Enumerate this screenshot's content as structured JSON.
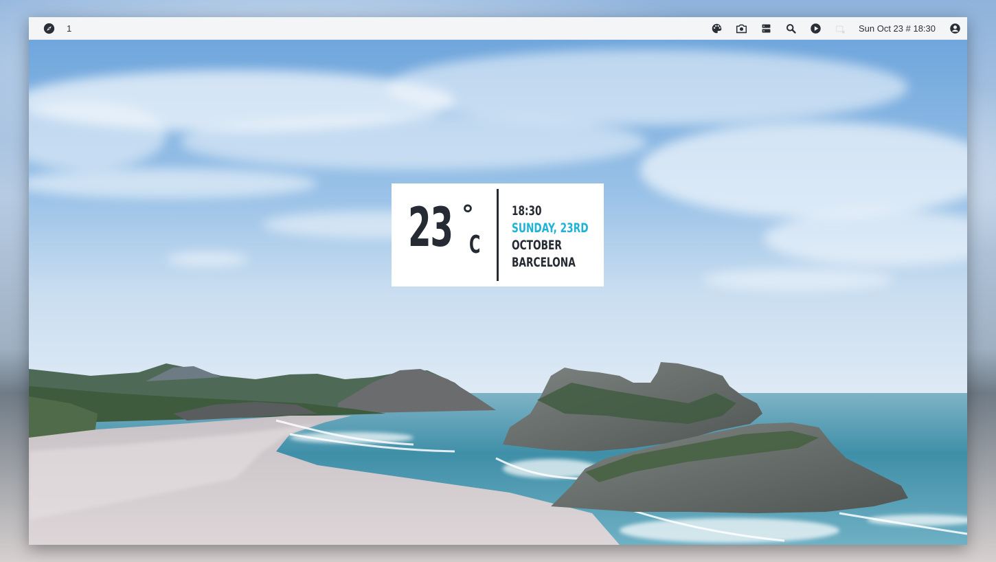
{
  "topbar": {
    "workspace_number": "1",
    "clock": "Sun Oct 23 # 18:30",
    "left_icons": [
      "compass-icon"
    ],
    "right_icons": [
      "palette-icon",
      "camera-icon",
      "server-icon",
      "search-icon",
      "play-icon",
      "battery-icon",
      "user-icon"
    ]
  },
  "widget": {
    "temperature": "23",
    "degree_symbol": "°",
    "unit": "C",
    "time": "18:30",
    "day": "SUNDAY, 23RD",
    "month": "OCTOBER",
    "city": "BARCELONA",
    "accent_color": "#1fb3d6",
    "text_color": "#252a33"
  },
  "colors": {
    "bar_background": "#f4f5f7",
    "sky": "#7fb0de",
    "sea": "#3f8fa8"
  }
}
